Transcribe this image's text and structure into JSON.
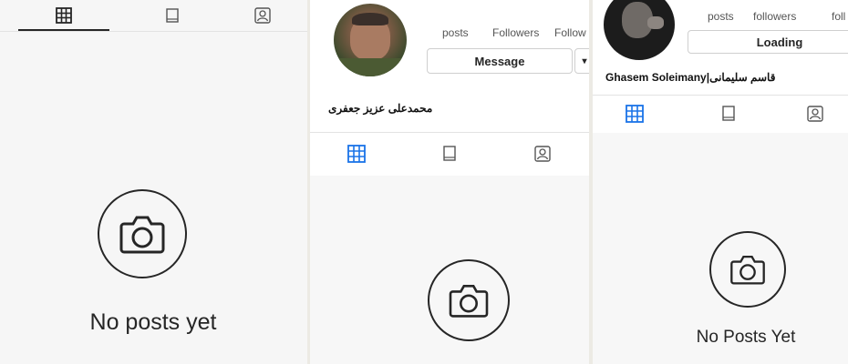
{
  "panels": [
    {
      "empty_state": {
        "message": "No posts yet"
      },
      "icons": {
        "tab_grid": "grid-icon",
        "tab_feed": "feed-icon",
        "tab_tagged": "tagged-icon",
        "empty": "camera-icon"
      }
    },
    {
      "stats": {
        "posts_label": "posts",
        "followers_label": "Followers",
        "following_label": "Follow"
      },
      "buttons": {
        "message_label": "Message",
        "dropdown_glyph": "▾"
      },
      "profile_name": "محمدعلی عزیز جعفری",
      "icons": {
        "tab_grid": "grid-icon",
        "tab_feed": "feed-icon",
        "tab_tagged": "tagged-icon",
        "empty": "camera-icon"
      }
    },
    {
      "stats": {
        "posts_label": "posts",
        "followers_label": "followers",
        "following_label": "foll"
      },
      "buttons": {
        "loading_label": "Loading"
      },
      "profile_name": "Ghasem Soleimany|قاسم سلیمانی",
      "empty_state": {
        "message": "No Posts Yet"
      },
      "icons": {
        "tab_grid": "grid-icon",
        "tab_feed": "feed-icon",
        "tab_tagged": "tagged-icon",
        "empty": "camera-icon"
      }
    }
  ],
  "colors": {
    "active_tab": "#1a73e8",
    "icon": "#262626",
    "text": "#262626"
  }
}
